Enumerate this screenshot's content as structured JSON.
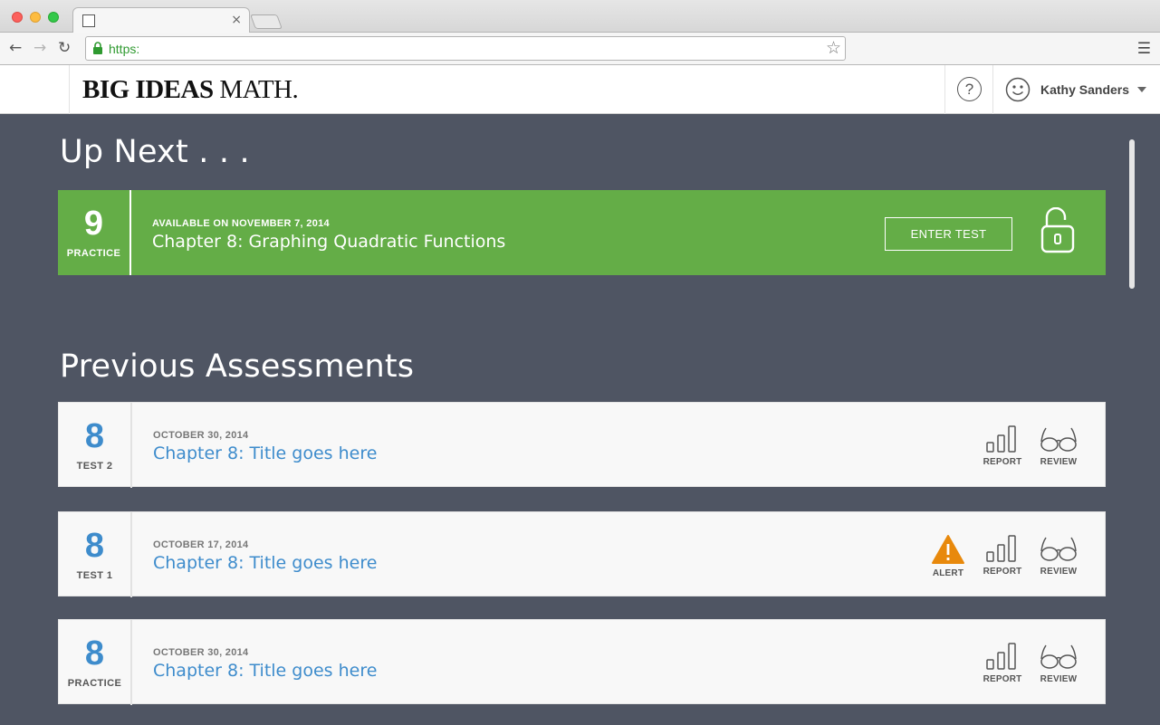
{
  "browser": {
    "url": "https:",
    "tab_close": "×"
  },
  "header": {
    "logo_bold": "BIG IDEAS",
    "logo_regular": " MATH",
    "logo_mark": ".",
    "help_icon": "?",
    "user_name": "Kathy Sanders"
  },
  "up_next": {
    "section_title": "Up Next . . .",
    "card": {
      "number": "9",
      "type_label": "PRACTICE",
      "date": "AVAILABLE ON NOVEMBER 7, 2014",
      "title": "Chapter 8: Graphing Quadratic Functions",
      "button_label": "ENTER TEST",
      "accent_color": "#64ad47"
    }
  },
  "previous": {
    "section_title": "Previous Assessments",
    "items": [
      {
        "number": "8",
        "type_label": "TEST 2",
        "date": "OCTOBER 30, 2014",
        "title": "Chapter 8: Title goes here",
        "report_label": "REPORT",
        "review_label": "REVIEW"
      },
      {
        "number": "8",
        "type_label": "TEST 1",
        "date": "OCTOBER 17, 2014",
        "title": "Chapter 8: Title goes here",
        "alert_label": "ALERT",
        "report_label": "REPORT",
        "review_label": "REVIEW"
      },
      {
        "number": "8",
        "type_label": "PRACTICE",
        "date": "OCTOBER 30, 2014",
        "title": "Chapter 8: Title goes here",
        "report_label": "REPORT",
        "review_label": "REVIEW"
      }
    ]
  },
  "colors": {
    "background": "#4f5563",
    "accent_blue": "#3e8ccc",
    "alert_orange": "#e8890c"
  }
}
